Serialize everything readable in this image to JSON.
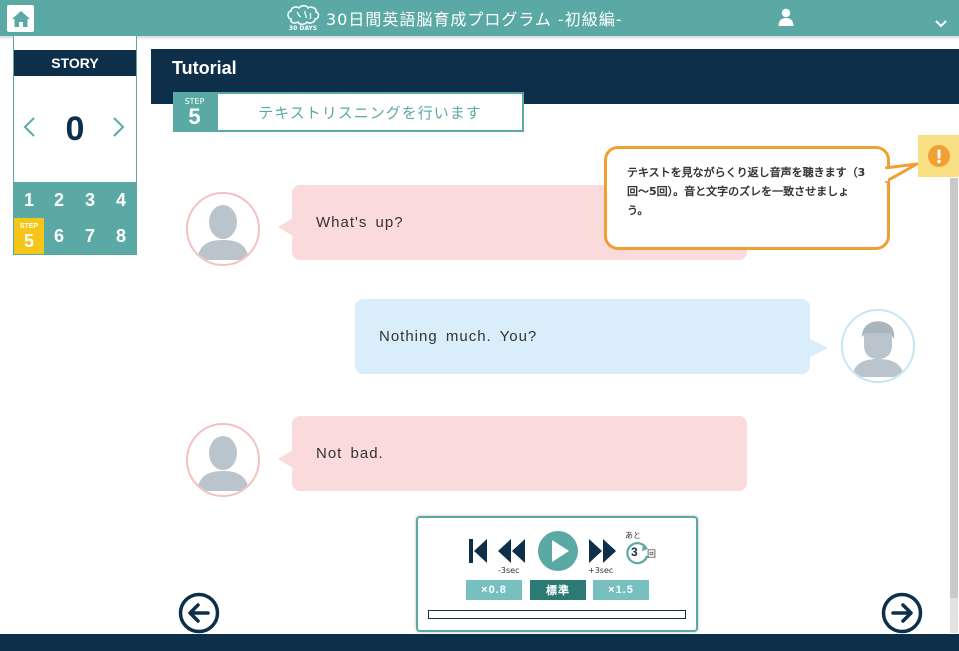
{
  "header": {
    "title": "30日間英語脳育成プログラム -初級編-",
    "logo_sub": "30 DAYS"
  },
  "sidebar": {
    "story_label": "STORY",
    "story_number": "0",
    "steps": [
      "1",
      "2",
      "3",
      "4",
      "5",
      "6",
      "7",
      "8"
    ],
    "active_step_tag": "STEP",
    "active_step": "5"
  },
  "main": {
    "title": "Tutorial",
    "step_tag": "STEP",
    "step_number": "5",
    "step_description": "テキストリスニングを行います"
  },
  "tooltip": {
    "text": "テキストを見ながらくり返し音声を聴きます（3回〜5回）。音と文字のズレを一致させましょう。"
  },
  "chat": [
    {
      "speaker": "left",
      "text": "What's up?"
    },
    {
      "speaker": "right",
      "text": "Nothing much.  You?"
    },
    {
      "speaker": "left",
      "text": "Not bad."
    }
  ],
  "player": {
    "back_label": "-3sec",
    "forward_label": "+3sec",
    "remaining_prefix": "あと",
    "remaining_count": "3",
    "remaining_unit": "回",
    "speeds": [
      "×0.8",
      "標準",
      "×1.5"
    ],
    "active_speed": "標準",
    "progress": 0
  },
  "colors": {
    "teal": "#5aa9a5",
    "navy": "#0d2f4a",
    "pink_bubble": "#fadadb",
    "blue_bubble": "#d9eefa",
    "alert_orange": "#f0a032",
    "step_yellow": "#f5c518"
  },
  "icons": [
    "home-icon",
    "brain-logo-icon",
    "user-icon",
    "chevron-down-icon",
    "chevron-left-icon",
    "chevron-right-icon",
    "alert-icon",
    "skip-to-start-icon",
    "rewind-icon",
    "play-icon",
    "fast-forward-icon",
    "repeat-icon",
    "arrow-left-circle-icon",
    "arrow-right-circle-icon"
  ]
}
